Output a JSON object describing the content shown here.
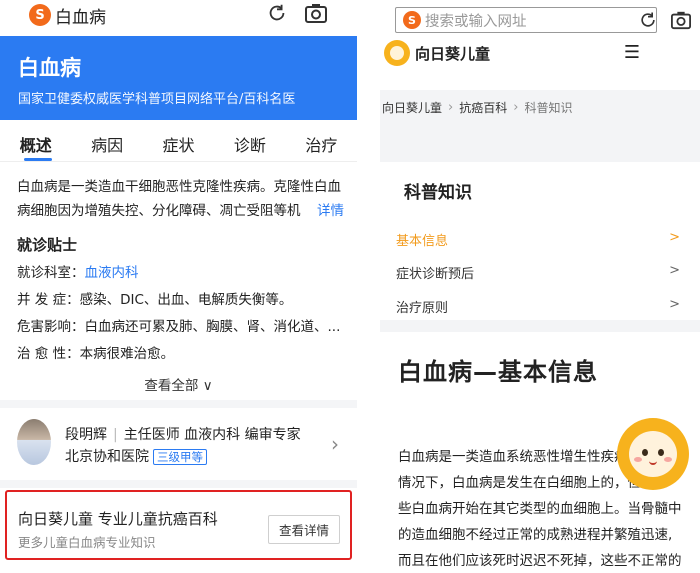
{
  "left": {
    "search": {
      "logo": "S",
      "query": "白血病"
    },
    "header": {
      "title": "白血病",
      "subtitle": "国家卫健委权威医学科普项目网络平台/百科名医"
    },
    "tabs": [
      "概述",
      "病因",
      "症状",
      "诊断",
      "治疗"
    ],
    "intro": {
      "line1": "白血病是一类造血干细胞恶性克隆性疾病。克隆性白血",
      "line2": "病细胞因为增殖失控、分化障碍、凋亡受阻等机",
      "more": "详情"
    },
    "tips": {
      "title": "就诊贴士",
      "dept_label": "就诊科室：",
      "dept_value": "血液内科",
      "comp": "并 发 症：感染、DIC、出血、电解质失衡等。",
      "harm": "危害影响：白血病还可累及肺、胸膜、肾、消化道、...",
      "cure": "治 愈 性：本病很难治愈。",
      "view_all": "查看全部 ∨"
    },
    "doctor": {
      "name": "段明辉",
      "title": "主任医师 血液内科 编审专家",
      "hospital": "北京协和医院",
      "grade": "三级甲等"
    },
    "card": {
      "title": "向日葵儿童 专业儿童抗癌百科",
      "subtitle": "更多儿童白血病专业知识",
      "button": "查看详情"
    }
  },
  "right": {
    "search": {
      "logo": "S",
      "placeholder": "搜索或输入网址"
    },
    "brand": "向日葵儿童",
    "menu": "☰",
    "breadcrumb": [
      "向日葵儿童",
      "抗癌百科",
      "科普知识"
    ],
    "kp": {
      "title": "科普知识",
      "items": [
        {
          "label": "基本信息",
          "arrow": ">"
        },
        {
          "label": "症状诊断预后",
          "arrow": ">"
        },
        {
          "label": "治疗原则",
          "arrow": ">"
        }
      ]
    },
    "article": {
      "title": "白血病—基本信息",
      "l1": "白血病是一类造血系统恶性增生性疾病",
      "l2": "情况下，白血病是发生在白细胞上的，但",
      "l3": "些白血病开始在其它类型的血细胞上。当骨髓中",
      "l4": "的造血细胞不经过正常的成熟进程并繁殖迅速,",
      "l5": "而且在他们应该死时迟迟不死掉，这些不正常的"
    }
  },
  "colors": {
    "brand_blue": "#2b7bf2",
    "highlight_orange": "#f29b1d",
    "card_border_red": "#e02222"
  }
}
